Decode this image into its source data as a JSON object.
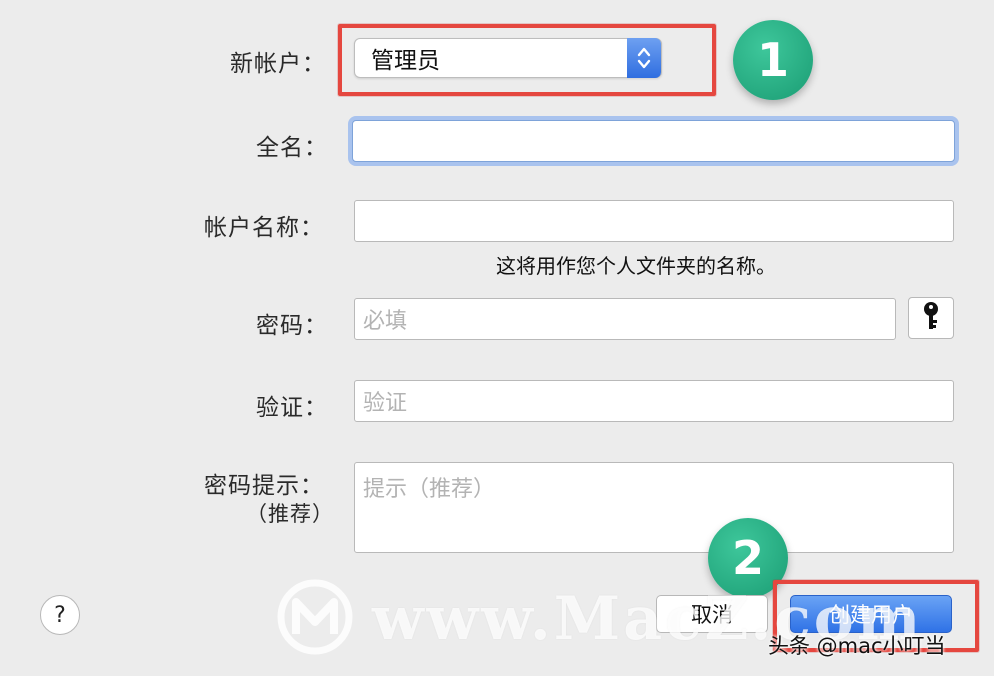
{
  "form": {
    "account_type": {
      "label": "新帐户：",
      "value": "管理员"
    },
    "full_name": {
      "label": "全名：",
      "value": ""
    },
    "account_name": {
      "label": "帐户名称：",
      "value": "",
      "hint": "这将用作您个人文件夹的名称。"
    },
    "password": {
      "label": "密码：",
      "placeholder": "必填"
    },
    "verify": {
      "label": "验证：",
      "placeholder": "验证"
    },
    "password_hint": {
      "label": "密码提示：",
      "label_sub": "（推荐）",
      "placeholder": "提示（推荐）"
    }
  },
  "buttons": {
    "help": "?",
    "cancel": "取消",
    "create": "创建用户"
  },
  "annotations": {
    "step1": "1",
    "step2": "2"
  },
  "watermark": {
    "text": "www.MacZ.com",
    "credit": "头条 @mac小叮当"
  },
  "colors": {
    "annotation_red": "#e5473f",
    "badge_green": "#1fa57a",
    "accent_blue": "#2f72e6"
  },
  "icons": {
    "popup": "up-down-chevron-icon",
    "password_assistant": "key-icon",
    "logo": "macz-m-logo-icon"
  }
}
